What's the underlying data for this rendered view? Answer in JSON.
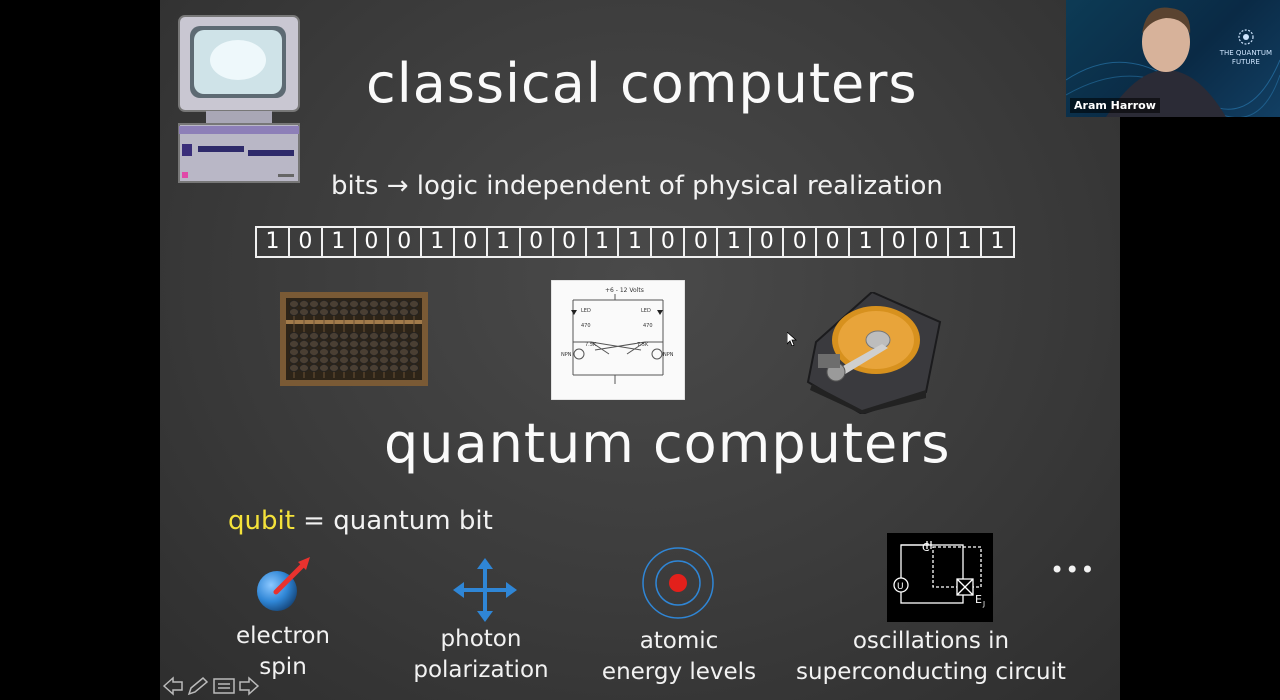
{
  "slide": {
    "title_classical": "classical computers",
    "subtitle": "bits → logic independent of physical realization",
    "bits": [
      "1",
      "0",
      "1",
      "0",
      "0",
      "1",
      "0",
      "1",
      "0",
      "0",
      "1",
      "1",
      "0",
      "0",
      "1",
      "0",
      "0",
      "0",
      "1",
      "0",
      "0",
      "1",
      "1"
    ],
    "circuit_text": "+6 - 12 Volts",
    "circuit_labels": [
      "LED",
      "LED",
      "470",
      "470",
      "7.5K",
      "7.5K",
      "NPN",
      "NPN"
    ],
    "title_quantum": "quantum computers",
    "qubit_word": "qubit",
    "qubit_rest": " = quantum bit",
    "examples": [
      {
        "line1": "electron",
        "line2": "spin"
      },
      {
        "line1": "photon",
        "line2": "polarization"
      },
      {
        "line1": "atomic",
        "line2": "energy levels"
      },
      {
        "line1": "oscillations in",
        "line2": "superconducting circuit"
      }
    ],
    "sc_labels": {
      "c": "C",
      "u": "U",
      "ej": "E",
      "ej_sub": "J"
    },
    "ellipsis": "•••"
  },
  "video": {
    "participant_name": "Aram Harrow",
    "brand_line1": "THE QUANTUM",
    "brand_line2": "FUTURE"
  },
  "colors": {
    "qubit_highlight": "#f4e23a",
    "spin_arrow": "#e8322e",
    "photon_blue": "#2f86d6",
    "atom_red": "#e3201b"
  },
  "icons": [
    "computer-icon",
    "abacus-image",
    "circuit-image",
    "hard-drive-image",
    "electron-spin-icon",
    "photon-polarization-icon",
    "atom-icon",
    "superconducting-circuit-icon",
    "previous-slide-icon",
    "pen-icon",
    "menu-icon",
    "next-slide-icon"
  ]
}
